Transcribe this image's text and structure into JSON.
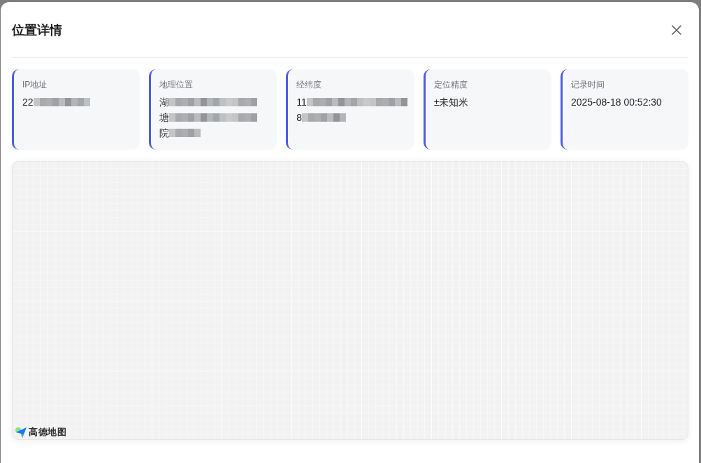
{
  "dialog": {
    "title": "位置详情"
  },
  "info_cards": [
    {
      "label": "IP地址",
      "lines": [
        {
          "text": "22",
          "redacted": true
        }
      ]
    },
    {
      "label": "地理位置",
      "lines": [
        {
          "text": "湖",
          "redacted": true
        },
        {
          "text": "塘",
          "redacted": true
        },
        {
          "text": "院",
          "redacted": true
        }
      ]
    },
    {
      "label": "经纬度",
      "lines": [
        {
          "text": "11",
          "redacted": true
        },
        {
          "text": "8",
          "redacted": true
        }
      ]
    },
    {
      "label": "定位精度",
      "lines": [
        {
          "text": "±未知米",
          "redacted": false
        }
      ]
    },
    {
      "label": "记录时间",
      "lines": [
        {
          "text": "2025-08-18 00:52:30",
          "redacted": false
        }
      ]
    }
  ],
  "map": {
    "attribution": "高德地图"
  }
}
